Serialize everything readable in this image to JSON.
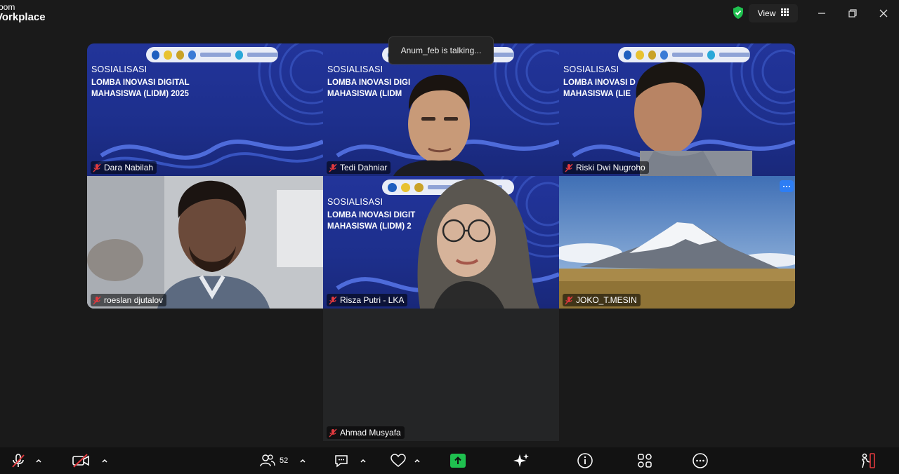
{
  "app": {
    "title_line1": "oom",
    "title_line2": "Vorkplace"
  },
  "header": {
    "view_label": "View"
  },
  "toast": {
    "text": "Anum_feb is talking..."
  },
  "banner": {
    "title": "SOSIALISASI",
    "subtitle_line1": "LOMBA INOVASI DIGITAL",
    "subtitle_line2": "MAHASISWA (LIDM) 2025",
    "subtitle_line1_cut": "LOMBA INOVASI DIGI",
    "subtitle_line2_cut": "MAHASISWA (LIDM",
    "subtitle_line1_cut2": "LOMBA INOVASI D",
    "subtitle_line2_cut2": "MAHASISWA (LIE",
    "subtitle_line1_cut3": "LOMBA INOVASI DIGIT",
    "subtitle_line2_cut3": "MAHASISWA (LIDM) 2"
  },
  "participants": [
    {
      "name": "Dara Nabilah"
    },
    {
      "name": "Tedi Dahniar"
    },
    {
      "name": "Riski Dwi Nugroho"
    },
    {
      "name": "roeslan djutalov"
    },
    {
      "name": "Risza Putri - LKA"
    },
    {
      "name": "JOKO_T.MESIN"
    },
    {
      "name": "Ahmad Musyafa"
    }
  ],
  "toolbar": {
    "participant_count": "52"
  },
  "colors": {
    "accent": "#2d7ef5",
    "share": "#1fc04f",
    "mute": "#e0393e",
    "banner_blue": "#22349a"
  }
}
